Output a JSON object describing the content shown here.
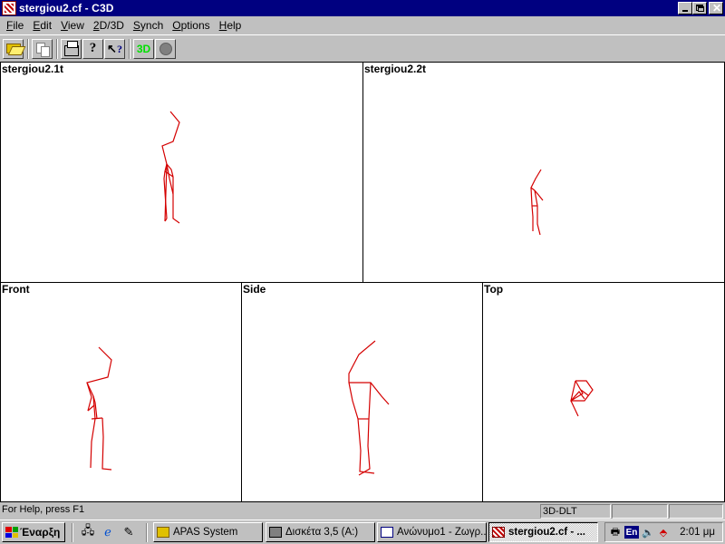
{
  "window": {
    "title": "stergiou2.cf - C3D",
    "icon": "c3d-app-icon"
  },
  "menu": [
    {
      "label": "File",
      "accel": "F",
      "rest": "ile"
    },
    {
      "label": "Edit",
      "accel": "E",
      "rest": "dit"
    },
    {
      "label": "View",
      "accel": "V",
      "rest": "iew"
    },
    {
      "label": "2D/3D",
      "accel": "2",
      "rest": "D/3D"
    },
    {
      "label": "Synch",
      "accel": "S",
      "rest": "ynch"
    },
    {
      "label": "Options",
      "accel": "O",
      "rest": "ptions"
    },
    {
      "label": "Help",
      "accel": "H",
      "rest": "elp"
    }
  ],
  "toolbar": {
    "buttons": [
      "open-folder-icon",
      "copy-icon",
      "print-icon",
      "help-icon",
      "context-help-icon",
      "3d-toggle",
      "record-icon"
    ],
    "btn_3d_label": "3D",
    "help_glyph": "?",
    "context_help_glyph": "?"
  },
  "panes": {
    "cam1_title": "stergiou2.1t",
    "cam2_title": "stergiou2.2t",
    "front_title": "Front",
    "side_title": "Side",
    "top_title": "Top",
    "stick_color": "#d40000"
  },
  "statusbar": {
    "message": "For Help, press F1",
    "mode": "3D-DLT",
    "panel2": "",
    "panel3": ""
  },
  "taskbar": {
    "start_label": "Έναρξη",
    "tasks": [
      {
        "label": "APAS System",
        "icon": "folder-icon"
      },
      {
        "label": "Δισκέτα 3,5 (A:)",
        "icon": "floppy-icon"
      },
      {
        "label": "Ανώνυμο1 - Ζωγρ...",
        "icon": "paint-icon"
      },
      {
        "label": "stergiou2.cf - ...",
        "icon": "c3d-app-icon"
      }
    ],
    "tray_lang": "En",
    "clock": "2:01 μμ"
  }
}
